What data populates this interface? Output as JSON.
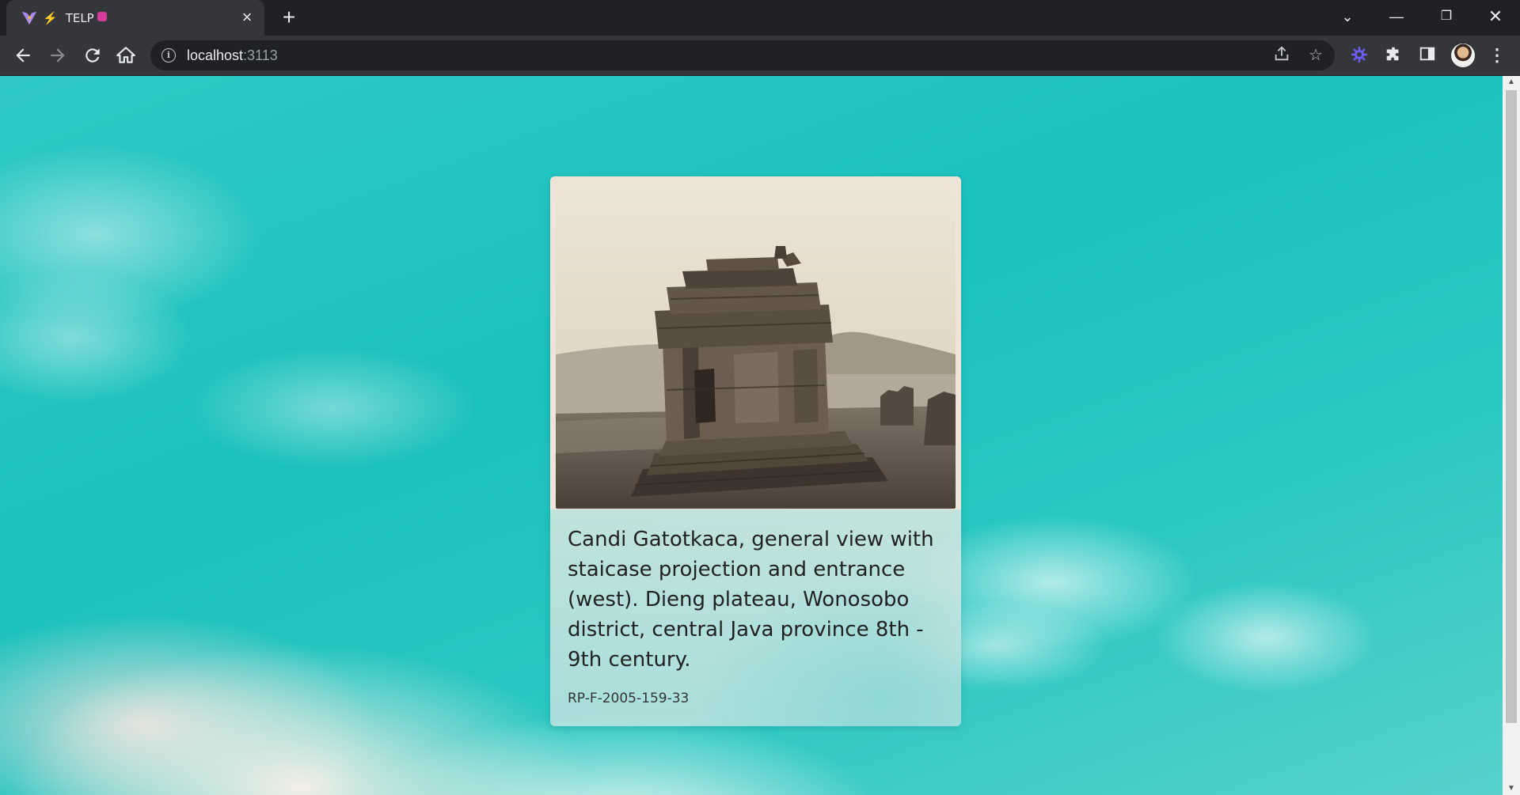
{
  "browser": {
    "tab": {
      "title": "TELP"
    },
    "address_bar": {
      "host": "localhost",
      "port": ":3113"
    }
  },
  "card": {
    "caption": "Candi Gatotkaca, general view with staicase projection and entrance (west). Dieng plateau, Wonosobo district, central Java province 8th - 9th century.",
    "object_id": "RP-F-2005-159-33"
  },
  "colors": {
    "chrome_dark": "#202124",
    "chrome_toolbar": "#35363a",
    "sky_teal": "#1bc1bd",
    "extension_accent": "#6b5cf2"
  },
  "icons": {
    "favicon": "vite-logo",
    "back": "arrow-left-icon",
    "forward": "arrow-right-icon",
    "reload": "reload-icon",
    "home": "home-icon",
    "info": "info-icon",
    "share": "share-icon",
    "bookmark": "star-icon",
    "extension": "gear-icon",
    "extensions": "puzzle-icon",
    "side_panel": "side-panel-icon",
    "menu": "kebab-menu-icon"
  }
}
